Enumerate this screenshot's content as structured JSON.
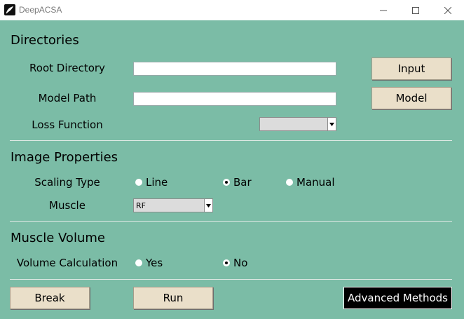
{
  "window": {
    "title": "DeepACSA",
    "controls": [
      "minimize-icon",
      "maximize-icon",
      "close-icon"
    ]
  },
  "colors": {
    "background": "#7bbca6",
    "button": "#eadfc9",
    "dark_button": "#000000"
  },
  "directories": {
    "heading": "Directories",
    "root_label": "Root Directory",
    "root_value": "",
    "model_label": "Model Path",
    "model_value": "",
    "loss_label": "Loss Function",
    "loss_value": "",
    "input_button": "Input",
    "model_button": "Model"
  },
  "image_properties": {
    "heading": "Image Properties",
    "scaling_label": "Scaling Type",
    "scaling_options": [
      "Line",
      "Bar",
      "Manual"
    ],
    "scaling_selected": "Bar",
    "muscle_label": "Muscle",
    "muscle_value": "RF"
  },
  "muscle_volume": {
    "heading": "Muscle Volume",
    "volume_label": "Volume Calculation",
    "options": [
      "Yes",
      "No"
    ],
    "selected": "No"
  },
  "actions": {
    "break": "Break",
    "run": "Run",
    "advanced": "Advanced Methods"
  }
}
